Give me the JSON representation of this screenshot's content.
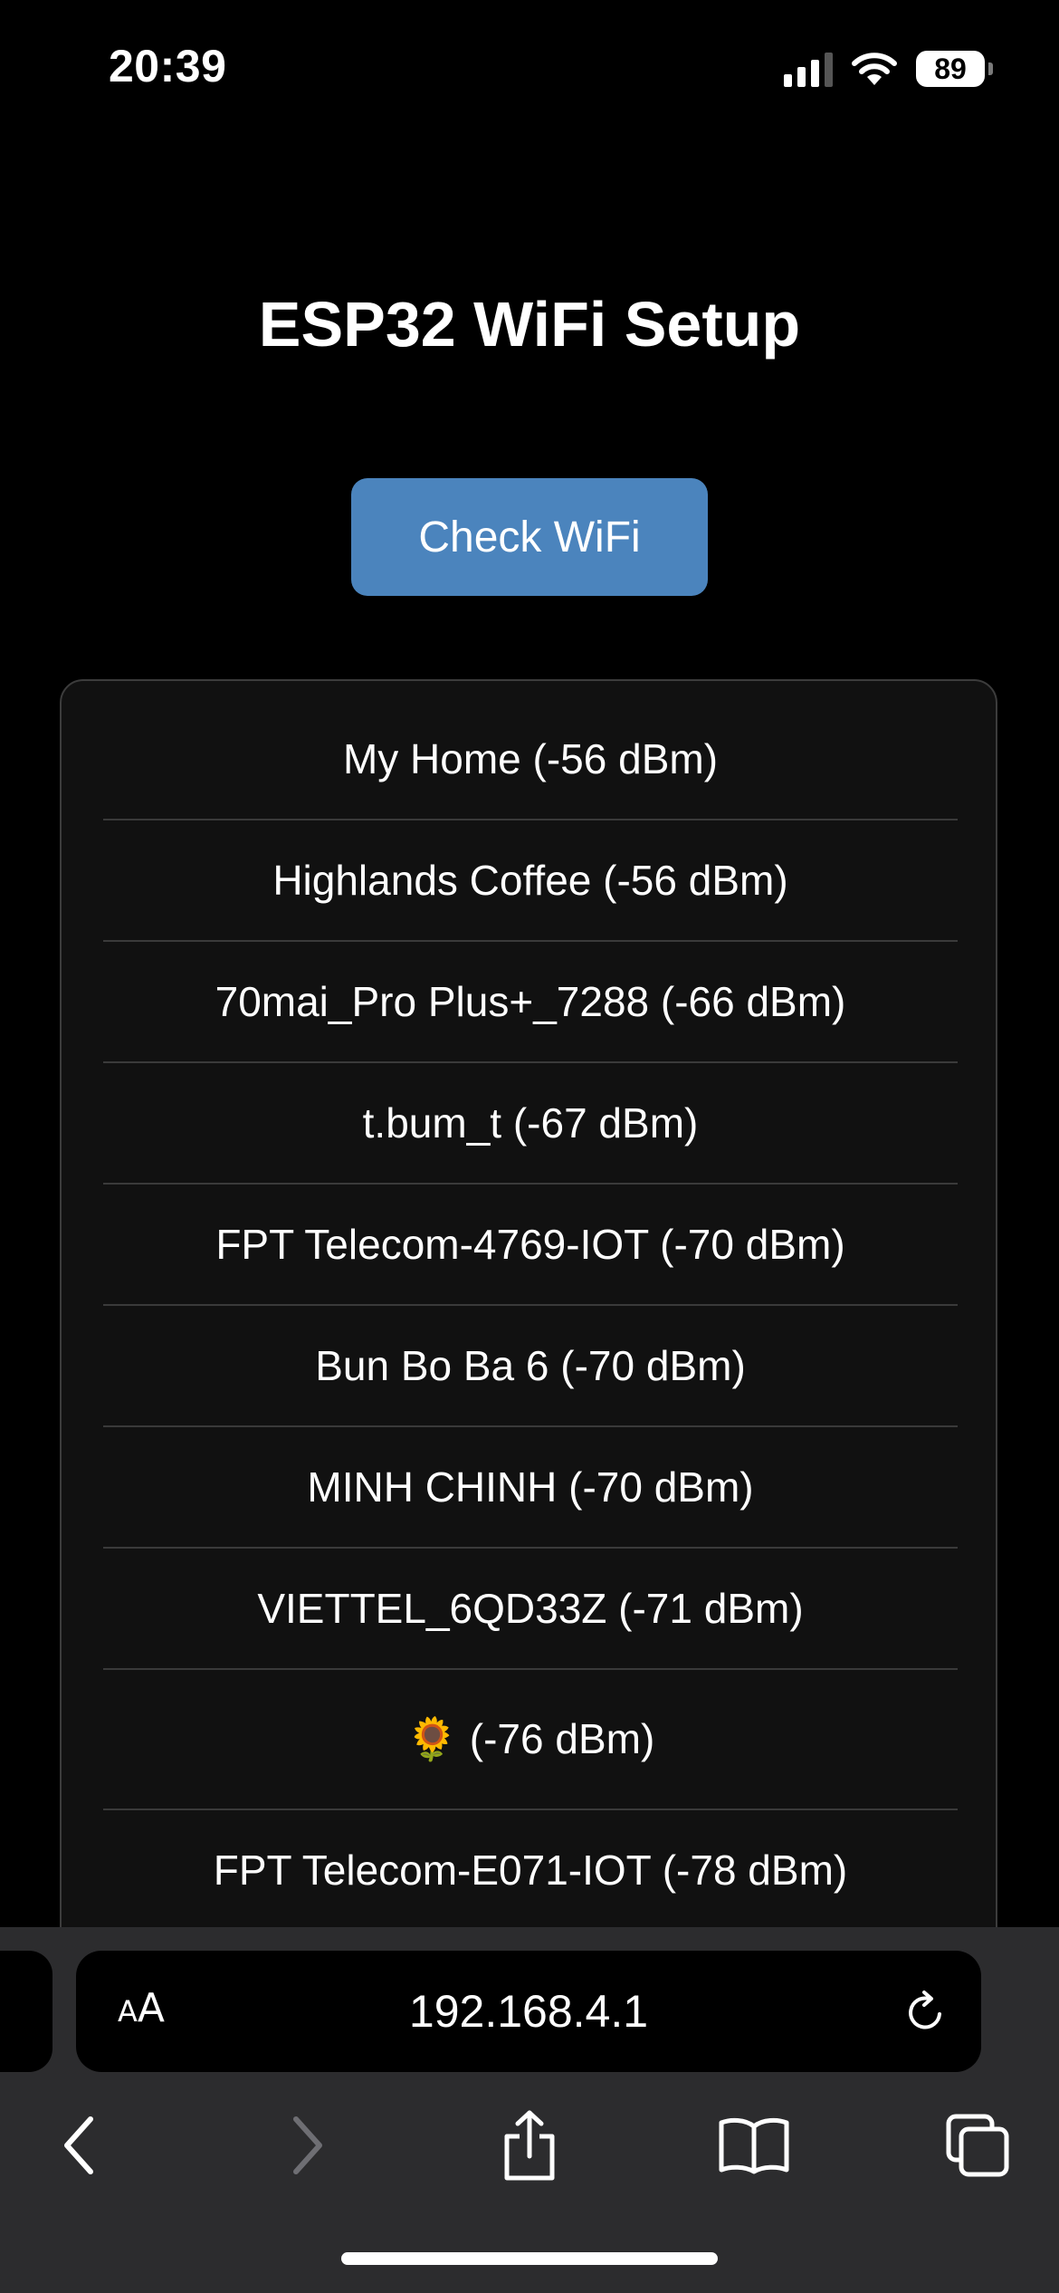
{
  "status_bar": {
    "time": "20:39",
    "battery": "89"
  },
  "page": {
    "title": "ESP32 WiFi Setup",
    "check_button_label": "Check WiFi"
  },
  "networks": [
    "My Home (-56 dBm)",
    "Highlands Coffee (-56 dBm)",
    "70mai_Pro Plus+_7288 (-66 dBm)",
    "t.bum_t (-67 dBm)",
    "FPT Telecom-4769-IOT (-70 dBm)",
    "Bun Bo Ba 6 (-70 dBm)",
    "MINH CHINH (-70 dBm)",
    "VIETTEL_6QD33Z (-71 dBm)",
    "🌻 (-76 dBm)",
    "FPT Telecom-E071-IOT (-78 dBm)"
  ],
  "browser": {
    "aa_small": "A",
    "aa_large": "A",
    "url": "192.168.4.1"
  },
  "colors": {
    "accent_button": "#4b84bd",
    "panel_bg": "#111111",
    "toolbar_bg": "#2c2c2e"
  }
}
